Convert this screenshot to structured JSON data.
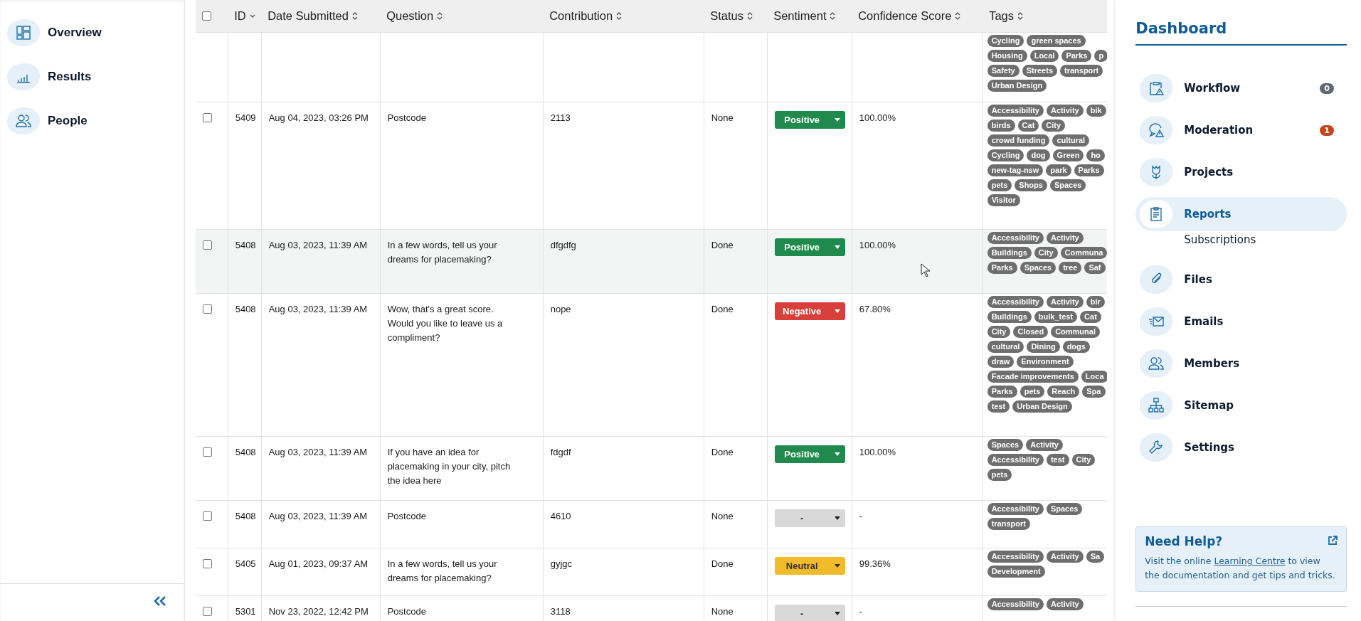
{
  "left_nav": {
    "items": [
      {
        "label": "Overview",
        "selected": false
      },
      {
        "label": "Results",
        "selected": false
      },
      {
        "label": "People",
        "selected": false
      }
    ]
  },
  "table": {
    "select_all": {
      "checked": false
    },
    "columns": [
      {
        "label": "ID",
        "sorted": true
      },
      {
        "label": "Date Submitted",
        "sorted": false
      },
      {
        "label": "Question",
        "sorted": false
      },
      {
        "label": "Contribution",
        "sorted": false
      },
      {
        "label": "Status",
        "sorted": false
      },
      {
        "label": "Sentiment",
        "sorted": false
      },
      {
        "label": "Confidence Score",
        "sorted": false
      },
      {
        "label": "Tags",
        "sorted": false
      }
    ],
    "rows": [
      {
        "highlighted": false,
        "tag_lines": [
          [
            "Cycling",
            "green spaces"
          ],
          [
            "Housing",
            "Local",
            "Parks",
            "p"
          ],
          [
            "Safety",
            "Streets",
            "transport"
          ],
          [
            "Urban Design"
          ]
        ]
      },
      {
        "checked": false,
        "highlighted": false,
        "id": "5409",
        "date": "Aug 04, 2023, 03:26 PM",
        "question": "Postcode",
        "contribution": "2113",
        "status": "None",
        "sentiment": {
          "label": "Positive",
          "kind": "positive"
        },
        "confidence": "100.00%",
        "tag_lines": [
          [
            "Accessibility",
            "Activity",
            "bik"
          ],
          [
            "birds",
            "Cat",
            "City"
          ],
          [
            "crowd funding",
            "cultural"
          ],
          [
            "Cycling",
            "dog",
            "Green",
            "ho"
          ],
          [
            "new-tag-nsw",
            "park",
            "Parks"
          ],
          [
            "pets",
            "Shops",
            "Spaces"
          ],
          [
            "Visitor"
          ]
        ]
      },
      {
        "checked": false,
        "highlighted": true,
        "id": "5408",
        "date": "Aug 03, 2023, 11:39 AM",
        "question": "In a few words, tell us your dreams for placemaking?",
        "contribution": "dfgdfg",
        "status": "Done",
        "sentiment": {
          "label": "Positive",
          "kind": "positive"
        },
        "confidence": "100.00%",
        "tag_lines": [
          [
            "Accessibility",
            "Activity"
          ],
          [
            "Buildings",
            "City",
            "Communa"
          ],
          [
            "Parks",
            "Spaces",
            "tree",
            "Saf"
          ]
        ]
      },
      {
        "checked": false,
        "highlighted": false,
        "id": "5408",
        "date": "Aug 03, 2023, 11:39 AM",
        "question": "Wow, that's a great score. Would you like to leave us a compliment?",
        "contribution": "nope",
        "status": "Done",
        "sentiment": {
          "label": "Negative",
          "kind": "negative"
        },
        "confidence": "67.80%",
        "tag_lines": [
          [
            "Accessibility",
            "Activity",
            "bir"
          ],
          [
            "Buildings",
            "bulk_test",
            "Cat"
          ],
          [
            "City",
            "Closed",
            "Communal"
          ],
          [
            "cultural",
            "Dining",
            "dogs"
          ],
          [
            "draw",
            "Environment"
          ],
          [
            "Facade improvements",
            "Loca"
          ],
          [
            "Parks",
            "pets",
            "Reach",
            "Spa"
          ],
          [
            "test",
            "Urban Design"
          ]
        ]
      },
      {
        "checked": false,
        "highlighted": false,
        "id": "5408",
        "date": "Aug 03, 2023, 11:39 AM",
        "question": "If you have an idea for placemaking in your city, pitch the idea here",
        "contribution": "fdgdf",
        "status": "Done",
        "sentiment": {
          "label": "Positive",
          "kind": "positive"
        },
        "confidence": "100.00%",
        "tag_lines": [
          [
            "Spaces",
            "Activity"
          ],
          [
            "Accessibility",
            "test",
            "City"
          ],
          [
            "pets"
          ]
        ]
      },
      {
        "checked": false,
        "highlighted": false,
        "id": "5408",
        "date": "Aug 03, 2023, 11:39 AM",
        "question": "Postcode",
        "contribution": "4610",
        "status": "None",
        "sentiment": {
          "label": "-",
          "kind": "none"
        },
        "confidence": "-",
        "tag_lines": [
          [
            "Accessibility",
            "Spaces"
          ],
          [
            "transport"
          ]
        ]
      },
      {
        "checked": false,
        "highlighted": false,
        "id": "5405",
        "date": "Aug 01, 2023, 09:37 AM",
        "question": "In a few words, tell us your dreams for placemaking?",
        "contribution": "gyjgc",
        "status": "Done",
        "sentiment": {
          "label": "Neutral",
          "kind": "neutral"
        },
        "confidence": "99.36%",
        "tag_lines": [
          [
            "Accessibility",
            "Activity",
            "Sa"
          ],
          [
            "Development"
          ]
        ]
      },
      {
        "checked": false,
        "highlighted": false,
        "id": "5301",
        "date": "Nov 23, 2022, 12:42 PM",
        "question": "Postcode",
        "contribution": "3118",
        "status": "None",
        "sentiment": {
          "label": "-",
          "kind": "none"
        },
        "confidence": "-",
        "tag_lines": [
          [
            "Accessibility",
            "Activity"
          ]
        ]
      }
    ]
  },
  "dashboard": {
    "title": "Dashboard",
    "items": [
      {
        "label": "Workflow",
        "selected": false,
        "badge": "0",
        "color": "#5f6770"
      },
      {
        "label": "Moderation",
        "selected": false,
        "badge": "1",
        "color": "#c2451e"
      },
      {
        "label": "Projects",
        "selected": false
      },
      {
        "label": "Reports",
        "selected": true,
        "children": [
          {
            "label": "Subscriptions",
            "selected": false
          }
        ]
      },
      {
        "label": "Files",
        "selected": false
      },
      {
        "label": "Emails",
        "selected": false
      },
      {
        "label": "Members",
        "selected": false
      },
      {
        "label": "Sitemap",
        "selected": false
      },
      {
        "label": "Settings",
        "selected": false
      }
    ]
  },
  "help": {
    "title": "Need Help?",
    "text_before": "Visit the online ",
    "link": "Learning Centre",
    "text_after": " to view the documentation and get tips and tricks."
  }
}
